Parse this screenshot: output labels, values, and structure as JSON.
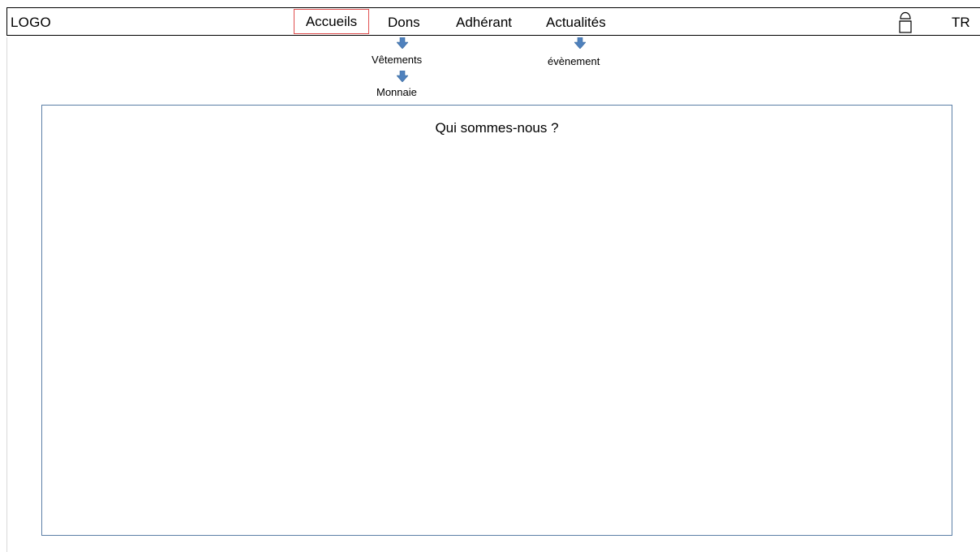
{
  "header": {
    "logo": "LOGO",
    "nav": [
      {
        "label": "Accueils",
        "selected": true
      },
      {
        "label": "Dons"
      },
      {
        "label": "Adhérant"
      },
      {
        "label": "Actualités"
      }
    ],
    "language": "TR",
    "user_icon": "user-icon"
  },
  "submenus": {
    "dons": [
      "Vêtements",
      "Monnaie"
    ],
    "actualites": [
      "évènement"
    ]
  },
  "main": {
    "title": "Qui sommes-nous ?"
  },
  "colors": {
    "selected_border": "#e05050",
    "arrow": "#4f81bd",
    "content_border": "#5b7fa6"
  }
}
